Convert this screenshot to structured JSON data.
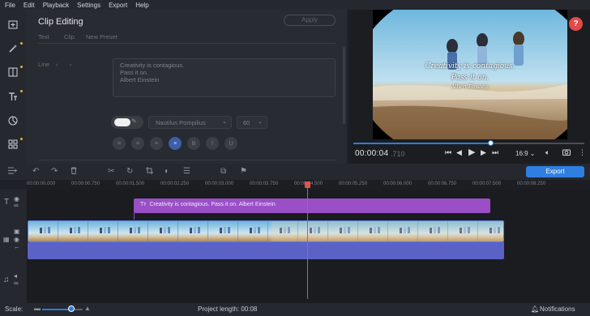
{
  "menu": [
    "File",
    "Edit",
    "Playback",
    "Settings",
    "Export",
    "Help"
  ],
  "panel": {
    "title": "Clip Editing",
    "apply_label": "Apply",
    "tabs": [
      "Text",
      "Clip",
      "New Preset"
    ],
    "line_label": "Line",
    "line_arrows": "‹ ›",
    "text_lines": [
      "Creativity is contagious.",
      "Pass it on.",
      "Albert Einstein"
    ],
    "font_value": "Nautilus Pompilius",
    "size_value": "60",
    "format_buttons": [
      "align-left-icon",
      "align-center-icon",
      "align-right-icon",
      "align-justify-icon",
      "bold-icon",
      "italic-icon",
      "underline-icon"
    ]
  },
  "player": {
    "caption_line1": "Creativity is contagious.",
    "caption_line2": "Pass it on.",
    "caption_line3": "Albert Einstein",
    "timecode": "00:00:04",
    "timecode_ms": ".710",
    "aspect_ratio": "16:9",
    "progress": 0.59,
    "help": "?"
  },
  "toolbar": {
    "export_label": "Export"
  },
  "ruler": [
    "00:00:00.000",
    "00:00:00.750",
    "00:00:01.500",
    "00:00:02.250",
    "00:00:03.000",
    "00:00:03.750",
    "00:00:04.500",
    "00:00:05.250",
    "00:00:06.000",
    "00:00:06.750",
    "00:00:07.500",
    "00:00:08.250"
  ],
  "timeline": {
    "title_clip_text": "Creativity is contagious. Pass it on. Albert Einstein"
  },
  "status": {
    "scale_label": "Scale:",
    "project_length": "Project length:  00:08",
    "notifications": "Notifications"
  },
  "colors": {
    "accent": "#2f7fe0",
    "title_clip": "#9a4fc7",
    "audio": "#5b62c6",
    "playhead": "#e3524d"
  }
}
